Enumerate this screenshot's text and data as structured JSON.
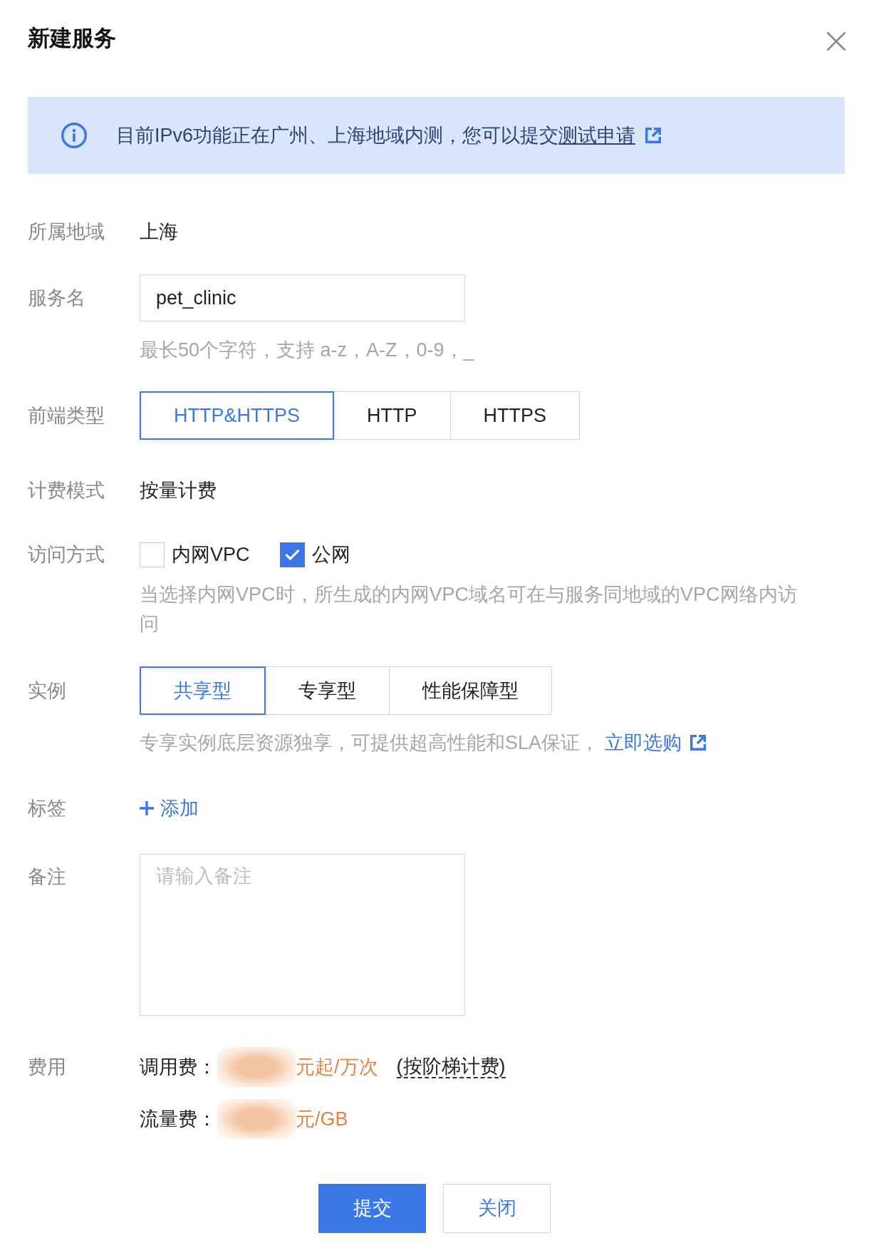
{
  "dialog": {
    "title": "新建服务"
  },
  "notice": {
    "text": "目前IPv6功能正在广州、上海地域内测，您可以提交",
    "link": "测试申请"
  },
  "form": {
    "rows": [
      {
        "kind": "text",
        "label": "所属地域",
        "value": "上海"
      },
      {
        "kind": "input",
        "label": "服务名",
        "value": "pet_clinic",
        "hint": "最长50个字符，支持 a-z，A-Z，0-9，_"
      },
      {
        "kind": "segmented",
        "label": "前端类型",
        "options": [
          {
            "label": "HTTP&HTTPS",
            "selected": true
          },
          {
            "label": "HTTP",
            "selected": false
          },
          {
            "label": "HTTPS",
            "selected": false
          }
        ]
      },
      {
        "kind": "text",
        "label": "计费模式",
        "value": "按量计费"
      },
      {
        "kind": "checkboxes",
        "label": "访问方式",
        "options": [
          {
            "label": "内网VPC",
            "checked": false
          },
          {
            "label": "公网",
            "checked": true
          }
        ],
        "hint": "当选择内网VPC时，所生成的内网VPC域名可在与服务同地域的VPC网络内访问"
      },
      {
        "kind": "segmented",
        "label": "实例",
        "options": [
          {
            "label": "共享型",
            "selected": true
          },
          {
            "label": "专享型",
            "selected": false
          },
          {
            "label": "性能保障型",
            "selected": false
          }
        ],
        "hint": "专享实例底层资源独享，可提供超高性能和SLA保证，",
        "hint_link": "立即选购"
      },
      {
        "kind": "add",
        "label": "标签",
        "action": "添加"
      },
      {
        "kind": "textarea",
        "label": "备注",
        "placeholder": "请输入备注"
      },
      {
        "kind": "fees",
        "label": "费用",
        "items": [
          {
            "name": "调用费：",
            "redacted": true,
            "unit": "元起/万次",
            "note": "(按阶梯计费)"
          },
          {
            "name": "流量费：",
            "redacted": true,
            "unit": "元/GB"
          }
        ]
      }
    ]
  },
  "buttons": [
    {
      "label": "提交",
      "kind": "primary"
    },
    {
      "label": "关闭",
      "kind": "secondary"
    }
  ]
}
